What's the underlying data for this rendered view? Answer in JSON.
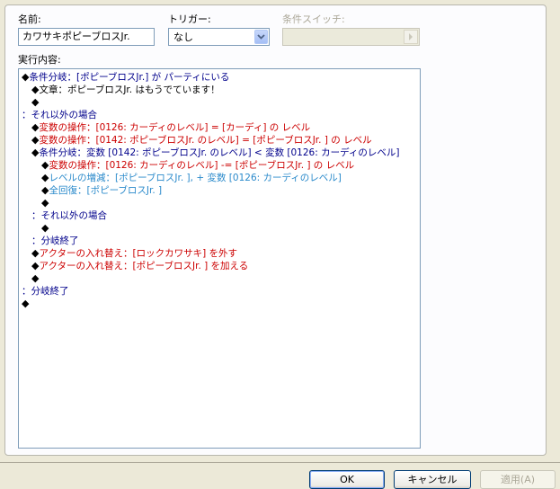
{
  "fields": {
    "name_label": "名前:",
    "name_value": "カワサキポピーブロスJr.",
    "trigger_label": "トリガー:",
    "trigger_value": "なし",
    "switch_label": "条件スイッチ:",
    "content_label": "実行内容:"
  },
  "commands": [
    {
      "indent": 0,
      "diamond": true,
      "color": "blue",
      "text": "条件分岐：[ポピーブロスJr.] が パーティにいる"
    },
    {
      "indent": 1,
      "diamond": true,
      "color": "black",
      "text": "文章：ポピーブロスJr. はもうでています！"
    },
    {
      "indent": 1,
      "diamond": true,
      "color": "black",
      "text": ""
    },
    {
      "indent": 0,
      "diamond": false,
      "color": "blue",
      "text": "：それ以外の場合"
    },
    {
      "indent": 1,
      "diamond": true,
      "color": "red",
      "text": "変数の操作：[0126: カーディのレベル] = [カーディ] の レベル"
    },
    {
      "indent": 1,
      "diamond": true,
      "color": "red",
      "text": "変数の操作：[0142: ポピーブロスJr. のレベル] = [ポピーブロスJr. ] の レベル"
    },
    {
      "indent": 1,
      "diamond": true,
      "color": "blue",
      "text": "条件分岐：変数 [0142: ポピーブロスJr. のレベル] < 変数 [0126: カーディのレベル]"
    },
    {
      "indent": 2,
      "diamond": true,
      "color": "red",
      "text": "変数の操作：[0126: カーディのレベル] -= [ポピーブロスJr. ] の レベル"
    },
    {
      "indent": 2,
      "diamond": true,
      "color": "cyan",
      "text": "レベルの増減：[ポピーブロスJr. ], + 変数 [0126: カーディのレベル]"
    },
    {
      "indent": 2,
      "diamond": true,
      "color": "cyan",
      "text": "全回復：[ポピーブロスJr. ]"
    },
    {
      "indent": 2,
      "diamond": true,
      "color": "black",
      "text": ""
    },
    {
      "indent": 1,
      "diamond": false,
      "color": "blue",
      "text": "：それ以外の場合"
    },
    {
      "indent": 2,
      "diamond": true,
      "color": "black",
      "text": ""
    },
    {
      "indent": 1,
      "diamond": false,
      "color": "blue",
      "text": "：分岐終了"
    },
    {
      "indent": 1,
      "diamond": true,
      "color": "red",
      "text": "アクターの入れ替え：[ロックカワサキ] を外す"
    },
    {
      "indent": 1,
      "diamond": true,
      "color": "red",
      "text": "アクターの入れ替え：[ポピーブロスJr. ] を加える"
    },
    {
      "indent": 1,
      "diamond": true,
      "color": "black",
      "text": ""
    },
    {
      "indent": 0,
      "diamond": false,
      "color": "blue",
      "text": "：分岐終了"
    },
    {
      "indent": 0,
      "diamond": true,
      "color": "black",
      "text": ""
    }
  ],
  "buttons": {
    "ok": "OK",
    "cancel": "キャンセル",
    "apply": "適用(A)"
  },
  "icons": {
    "trigger_dropdown": "chevron-down-icon",
    "switch_button": "chevron-right-icon",
    "command_marker": "diamond-icon"
  }
}
